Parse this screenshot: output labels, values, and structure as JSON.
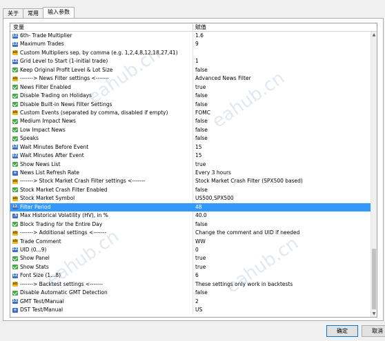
{
  "tabs": [
    {
      "label": "关于",
      "active": false
    },
    {
      "label": "常用",
      "active": false
    },
    {
      "label": "输入参数",
      "active": true
    }
  ],
  "table": {
    "col_variable": "变量",
    "col_value": "赋值",
    "rows": [
      {
        "icon": "int",
        "name": "6th- Trade Multiplier",
        "value": "1.6"
      },
      {
        "icon": "int",
        "name": "Maximum Trades",
        "value": "9"
      },
      {
        "icon": "str",
        "name": "Custom Multipliers sep. by comma (e.g. 1,2,4,8,12,18,27,41)",
        "value": ""
      },
      {
        "icon": "int",
        "name": "Grid Level to Start (1-initial trade)",
        "value": "1"
      },
      {
        "icon": "bool",
        "name": "Keep Original Profit Level & Lot Size",
        "value": "false"
      },
      {
        "icon": "str",
        "name": "-------> News Filter settings <-------",
        "value": "Advanced News Filter"
      },
      {
        "icon": "bool",
        "name": "News Filter Enabled",
        "value": "true"
      },
      {
        "icon": "bool",
        "name": "Disable Trading on Holidays",
        "value": "false"
      },
      {
        "icon": "bool",
        "name": "Disable Built-in News Filter Settings",
        "value": "false"
      },
      {
        "icon": "str",
        "name": "Custom Events (separated by comma, disabled if empty)",
        "value": "FOMC"
      },
      {
        "icon": "bool",
        "name": "Medium Impact News",
        "value": "false"
      },
      {
        "icon": "bool",
        "name": "Low Impact News",
        "value": "false"
      },
      {
        "icon": "bool",
        "name": "Speaks",
        "value": "false"
      },
      {
        "icon": "int",
        "name": "Wait Minutes Before Event",
        "value": "15"
      },
      {
        "icon": "int",
        "name": "Wait Minutes After Event",
        "value": "15"
      },
      {
        "icon": "bool",
        "name": "Show News List",
        "value": "true"
      },
      {
        "icon": "enum",
        "name": "News List Refresh Rate",
        "value": "Every 3 hours"
      },
      {
        "icon": "str",
        "name": "-------> Stock Market Crash Filter settings <-------",
        "value": "Stock Market Crash Filter (SPX500 based)"
      },
      {
        "icon": "bool",
        "name": "Stock Market Crash Filter Enabled",
        "value": "false"
      },
      {
        "icon": "str",
        "name": "Stock Market Symbol",
        "value": "US500,SPX500"
      },
      {
        "icon": "int",
        "name": "Filter Period",
        "value": "48",
        "selected": true
      },
      {
        "icon": "dbl",
        "name": "Max Historical Volatility (HV), in %",
        "value": "40.0"
      },
      {
        "icon": "bool",
        "name": "Block Trading for the Entire Day",
        "value": "false"
      },
      {
        "icon": "str",
        "name": "-------> Additional settings <-------",
        "value": "Change the comment and UID if needed"
      },
      {
        "icon": "str",
        "name": "Trade Comment",
        "value": "WW"
      },
      {
        "icon": "int",
        "name": "UID (0...9)",
        "value": "0"
      },
      {
        "icon": "bool",
        "name": "Show Panel",
        "value": "true"
      },
      {
        "icon": "bool",
        "name": "Show Stats",
        "value": "true"
      },
      {
        "icon": "int",
        "name": "Font Size (1...8)",
        "value": "6"
      },
      {
        "icon": "str",
        "name": "-------> Backtest settings <-------",
        "value": "These settings only work in backtests"
      },
      {
        "icon": "bool",
        "name": "Disable Automatic GMT Detection",
        "value": "false"
      },
      {
        "icon": "int",
        "name": "GMT Test/Manual",
        "value": "2"
      },
      {
        "icon": "enum",
        "name": "DST Test/Manual",
        "value": "US"
      }
    ]
  },
  "buttons": {
    "ok": "确定",
    "cancel": "取消"
  },
  "watermark": "eahub.cn"
}
